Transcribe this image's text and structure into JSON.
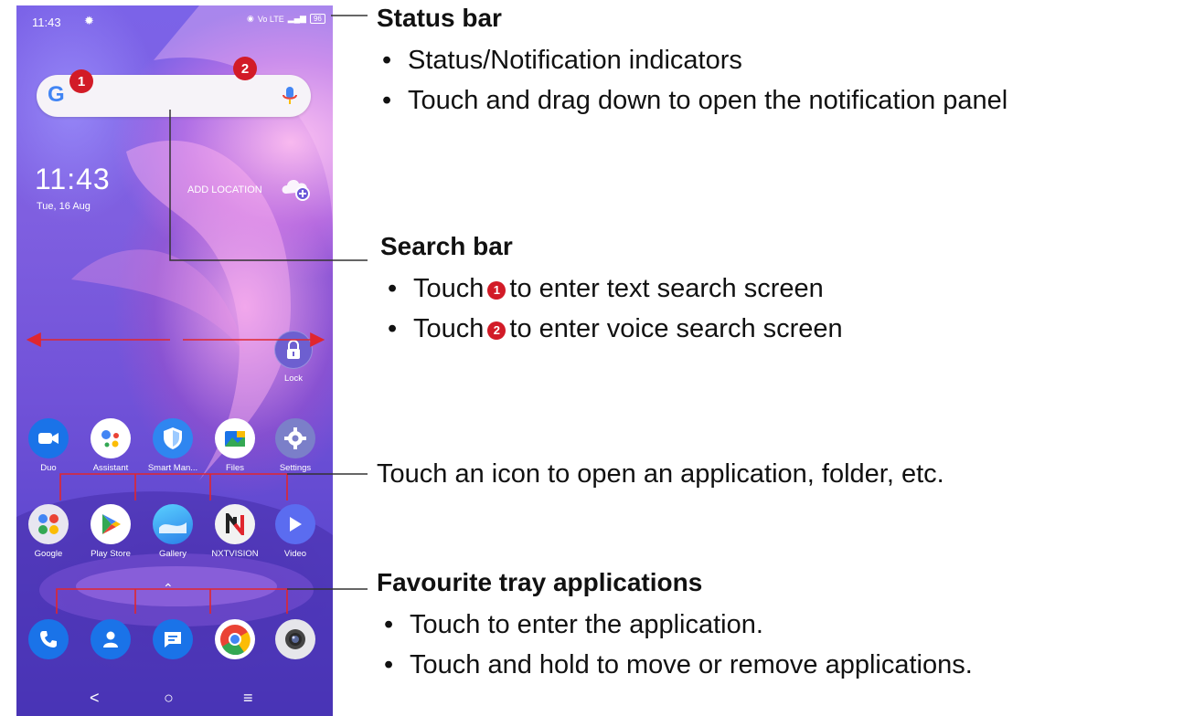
{
  "phone": {
    "status_time": "11:43",
    "status_icons_text": "Vo LTE",
    "battery": "96",
    "clock_time": "11:43",
    "date": "Tue, 16 Aug",
    "add_location": "ADD LOCATION",
    "callout_1": "1",
    "callout_2": "2",
    "lock_label": "Lock",
    "apps_row1": [
      {
        "label": "Duo",
        "icon": "duo-icon"
      },
      {
        "label": "Assistant",
        "icon": "assistant-icon"
      },
      {
        "label": "Smart Man...",
        "icon": "shield-icon"
      },
      {
        "label": "Files",
        "icon": "files-icon"
      },
      {
        "label": "Settings",
        "icon": "gear-icon"
      }
    ],
    "apps_row2": [
      {
        "label": "Google",
        "icon": "google-folder-icon"
      },
      {
        "label": "Play Store",
        "icon": "play-store-icon"
      },
      {
        "label": "Gallery",
        "icon": "gallery-icon"
      },
      {
        "label": "NXTVISION",
        "icon": "nxtvision-icon"
      },
      {
        "label": "Video",
        "icon": "video-icon"
      }
    ],
    "tray": [
      {
        "icon": "phone-icon"
      },
      {
        "icon": "contacts-icon"
      },
      {
        "icon": "messages-icon"
      },
      {
        "icon": "chrome-icon"
      },
      {
        "icon": "camera-icon"
      }
    ],
    "nav": {
      "back": "<",
      "home": "○",
      "recents": "≡"
    },
    "colors": {
      "callout": "#d21b27",
      "arrow": "#e0262e"
    }
  },
  "annotations": {
    "status_bar": {
      "title": "Status bar",
      "bullets": [
        "Status/Notification indicators",
        "Touch and drag down to open the notification panel"
      ]
    },
    "search_bar": {
      "title": "Search bar",
      "bullet1_pre": "Touch",
      "bullet1_num": "1",
      "bullet1_post": "to enter text search screen",
      "bullet2_pre": "Touch",
      "bullet2_num": "2",
      "bullet2_post": "to enter voice search screen"
    },
    "icons": "Touch an icon to open an application, folder, etc.",
    "favourite_tray": {
      "title": "Favourite tray applications",
      "bullets": [
        "Touch to enter the application.",
        "Touch and hold to move or remove applications."
      ]
    },
    "bullet_char": "•"
  }
}
